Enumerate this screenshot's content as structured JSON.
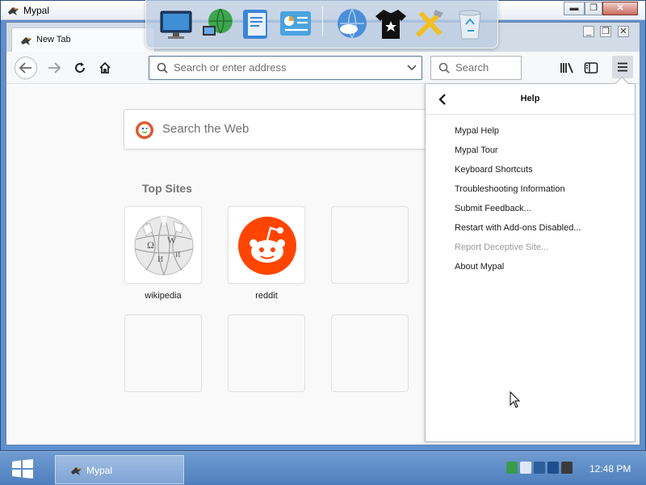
{
  "window": {
    "title": "Mypal",
    "app_icon": "mypal-icon"
  },
  "browser": {
    "tab_title": "New Tab",
    "url_placeholder": "Search or enter address",
    "search_placeholder": "Search"
  },
  "newtab": {
    "websearch_placeholder": "Search the Web",
    "top_sites_heading": "Top Sites",
    "sites": [
      {
        "label": "wikipedia",
        "icon": "wikipedia-globe-icon"
      },
      {
        "label": "reddit",
        "icon": "reddit-alien-icon",
        "color": "#ff4500"
      }
    ]
  },
  "help_panel": {
    "title": "Help",
    "items": [
      {
        "label": "Mypal Help",
        "enabled": true
      },
      {
        "label": "Mypal Tour",
        "enabled": true
      },
      {
        "label": "Keyboard Shortcuts",
        "enabled": true
      },
      {
        "label": "Troubleshooting Information",
        "enabled": true
      },
      {
        "label": "Submit Feedback...",
        "enabled": true
      },
      {
        "label": "Restart with Add-ons Disabled...",
        "enabled": true
      },
      {
        "label": "Report Deceptive Site...",
        "enabled": false
      },
      {
        "label": "About Mypal",
        "enabled": true
      }
    ]
  },
  "taskbar": {
    "task_label": "Mypal",
    "clock": "12:48 PM"
  },
  "colors": {
    "accent": "#5e8fcf",
    "reddit": "#ff4500",
    "duckduckgo": "#de5833"
  }
}
